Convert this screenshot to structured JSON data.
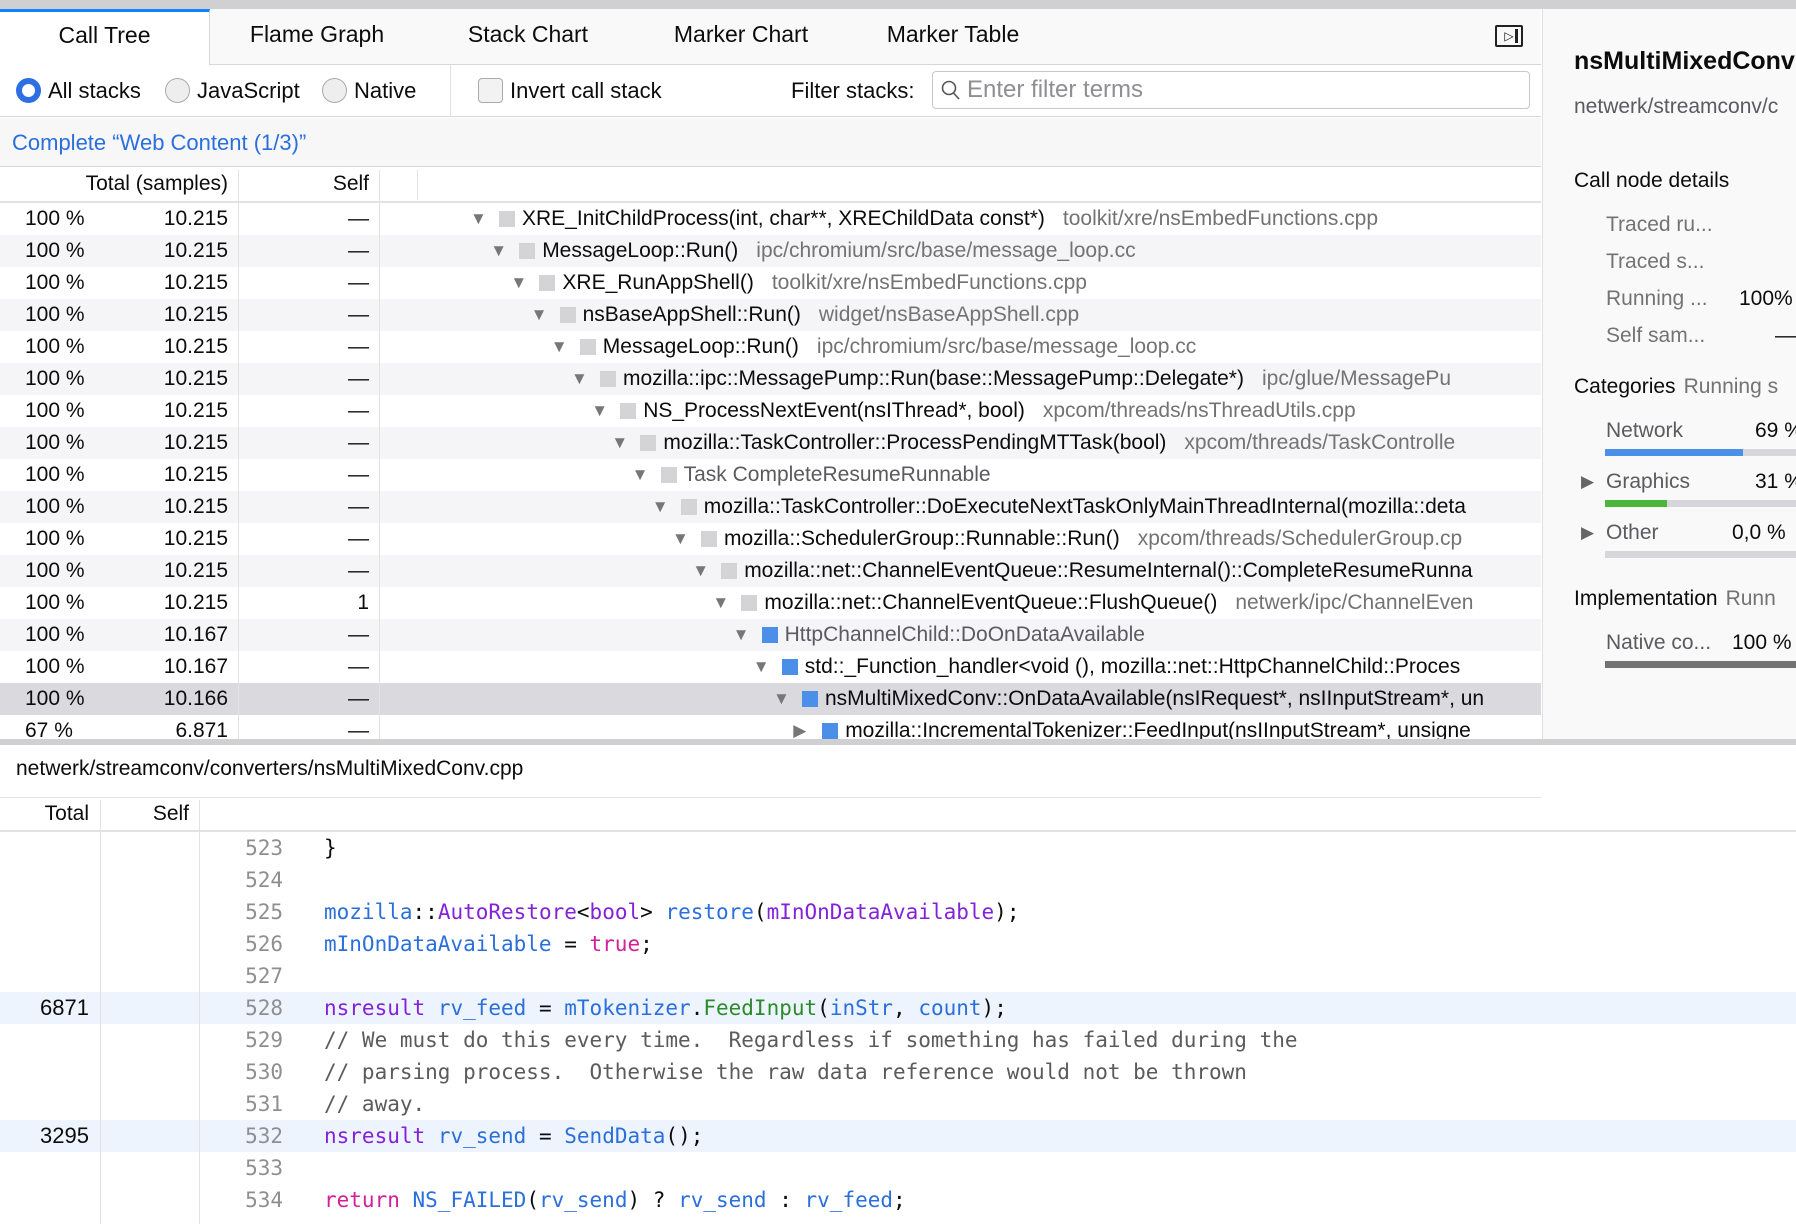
{
  "tabs": [
    {
      "label": "Call Tree",
      "selected": true
    },
    {
      "label": "Flame Graph"
    },
    {
      "label": "Stack Chart"
    },
    {
      "label": "Marker Chart"
    },
    {
      "label": "Marker Table"
    }
  ],
  "options": {
    "stack_types": [
      {
        "label": "All stacks",
        "checked": true
      },
      {
        "label": "JavaScript",
        "checked": false
      },
      {
        "label": "Native",
        "checked": false
      }
    ],
    "invert_label": "Invert call stack",
    "invert_checked": false,
    "filter_label": "Filter stacks:",
    "filter_placeholder": "Enter filter terms",
    "filter_value": ""
  },
  "breadcrumb": "Complete “Web Content (1/3)”",
  "tree": {
    "headers": {
      "total": "Total (samples)",
      "self": "Self"
    },
    "rows": [
      {
        "pct": "100 %",
        "total": "10.215",
        "self": "—",
        "depth": 0,
        "open": true,
        "cat": "#d4d4d7",
        "name": "XRE_InitChildProcess(int, char**, XREChildData const*)",
        "lib": "toolkit/xre/nsEmbedFunctions.cpp"
      },
      {
        "pct": "100 %",
        "total": "10.215",
        "self": "—",
        "depth": 1,
        "open": true,
        "cat": "#d4d4d7",
        "name": "MessageLoop::Run()",
        "lib": "ipc/chromium/src/base/message_loop.cc"
      },
      {
        "pct": "100 %",
        "total": "10.215",
        "self": "—",
        "depth": 2,
        "open": true,
        "cat": "#d4d4d7",
        "name": "XRE_RunAppShell()",
        "lib": "toolkit/xre/nsEmbedFunctions.cpp"
      },
      {
        "pct": "100 %",
        "total": "10.215",
        "self": "—",
        "depth": 3,
        "open": true,
        "cat": "#d4d4d7",
        "name": "nsBaseAppShell::Run()",
        "lib": "widget/nsBaseAppShell.cpp"
      },
      {
        "pct": "100 %",
        "total": "10.215",
        "self": "—",
        "depth": 4,
        "open": true,
        "cat": "#d4d4d7",
        "name": "MessageLoop::Run()",
        "lib": "ipc/chromium/src/base/message_loop.cc"
      },
      {
        "pct": "100 %",
        "total": "10.215",
        "self": "—",
        "depth": 5,
        "open": true,
        "cat": "#d4d4d7",
        "name": "mozilla::ipc::MessagePump::Run(base::MessagePump::Delegate*)",
        "lib": "ipc/glue/MessagePu"
      },
      {
        "pct": "100 %",
        "total": "10.215",
        "self": "—",
        "depth": 6,
        "open": true,
        "cat": "#d4d4d7",
        "name": "NS_ProcessNextEvent(nsIThread*, bool)",
        "lib": "xpcom/threads/nsThreadUtils.cpp"
      },
      {
        "pct": "100 %",
        "total": "10.215",
        "self": "—",
        "depth": 7,
        "open": true,
        "cat": "#d4d4d7",
        "name": "mozilla::TaskController::ProcessPendingMTTask(bool)",
        "lib": "xpcom/threads/TaskControlle"
      },
      {
        "pct": "100 %",
        "total": "10.215",
        "self": "—",
        "depth": 8,
        "open": true,
        "cat": "#d4d4d7",
        "name": "Task CompleteResumeRunnable",
        "lib": "",
        "dim": true
      },
      {
        "pct": "100 %",
        "total": "10.215",
        "self": "—",
        "depth": 9,
        "open": true,
        "cat": "#d4d4d7",
        "name": "mozilla::TaskController::DoExecuteNextTaskOnlyMainThreadInternal(mozilla::deta",
        "lib": ""
      },
      {
        "pct": "100 %",
        "total": "10.215",
        "self": "—",
        "depth": 10,
        "open": true,
        "cat": "#d4d4d7",
        "name": "mozilla::SchedulerGroup::Runnable::Run()",
        "lib": "xpcom/threads/SchedulerGroup.cp"
      },
      {
        "pct": "100 %",
        "total": "10.215",
        "self": "—",
        "depth": 11,
        "open": true,
        "cat": "#d4d4d7",
        "name": "mozilla::net::ChannelEventQueue::ResumeInternal()::CompleteResumeRunna",
        "lib": ""
      },
      {
        "pct": "100 %",
        "total": "10.215",
        "self": "1",
        "depth": 12,
        "open": true,
        "cat": "#d4d4d7",
        "name": "mozilla::net::ChannelEventQueue::FlushQueue()",
        "lib": "netwerk/ipc/ChannelEven"
      },
      {
        "pct": "100 %",
        "total": "10.167",
        "self": "—",
        "depth": 13,
        "open": true,
        "cat": "#4a90e8",
        "name": "HttpChannelChild::DoOnDataAvailable",
        "lib": "",
        "dim": true
      },
      {
        "pct": "100 %",
        "total": "10.167",
        "self": "—",
        "depth": 14,
        "open": true,
        "cat": "#4a90e8",
        "name": "std::_Function_handler<void (), mozilla::net::HttpChannelChild::Proces",
        "lib": ""
      },
      {
        "pct": "100 %",
        "total": "10.166",
        "self": "—",
        "depth": 15,
        "open": true,
        "cat": "#4a90e8",
        "name": "nsMultiMixedConv::OnDataAvailable(nsIRequest*, nsIInputStream*, un",
        "lib": "",
        "selected": true
      },
      {
        "pct": "67 %",
        "total": "6.871",
        "self": "—",
        "depth": 16,
        "open": false,
        "cat": "#4a90e8",
        "name": "mozilla::IncrementalTokenizer::FeedInput(nsIInputStream*, unsigne",
        "lib": ""
      }
    ]
  },
  "source": {
    "path": "netwerk/streamconv/converters/nsMultiMixedConv.cpp",
    "headers": {
      "total": "Total",
      "self": "Self"
    },
    "lines": [
      {
        "no": "523",
        "total": "",
        "tokens": [
          [
            "p",
            "}"
          ]
        ]
      },
      {
        "no": "524",
        "total": "",
        "tokens": []
      },
      {
        "no": "525",
        "total": "",
        "tokens": [
          [
            "id",
            "mozilla"
          ],
          [
            "p",
            "::"
          ],
          [
            "type",
            "AutoRestore"
          ],
          [
            "p",
            "<"
          ],
          [
            "type",
            "bool"
          ],
          [
            "p",
            "> "
          ],
          [
            "id",
            "restore"
          ],
          [
            "p",
            "("
          ],
          [
            "type",
            "mInOnDataAvailable"
          ],
          [
            "p",
            ");"
          ]
        ]
      },
      {
        "no": "526",
        "total": "",
        "tokens": [
          [
            "id",
            "mInOnDataAvailable"
          ],
          [
            "p",
            " = "
          ],
          [
            "kw",
            "true"
          ],
          [
            "p",
            ";"
          ]
        ]
      },
      {
        "no": "527",
        "total": "",
        "tokens": []
      },
      {
        "no": "528",
        "total": "6871",
        "tokens": [
          [
            "type",
            "nsresult"
          ],
          [
            "p",
            " "
          ],
          [
            "id",
            "rv_feed"
          ],
          [
            "p",
            " = "
          ],
          [
            "id",
            "mTokenizer"
          ],
          [
            "p",
            "."
          ],
          [
            "fn",
            "FeedInput"
          ],
          [
            "p",
            "("
          ],
          [
            "id",
            "inStr"
          ],
          [
            "p",
            ", "
          ],
          [
            "id",
            "count"
          ],
          [
            "p",
            ");"
          ]
        ]
      },
      {
        "no": "529",
        "total": "",
        "tokens": [
          [
            "cm",
            "// We must do this every time.  Regardless if something has failed during the"
          ]
        ]
      },
      {
        "no": "530",
        "total": "",
        "tokens": [
          [
            "cm",
            "// parsing process.  Otherwise the raw data reference would not be thrown"
          ]
        ]
      },
      {
        "no": "531",
        "total": "",
        "tokens": [
          [
            "cm",
            "// away."
          ]
        ]
      },
      {
        "no": "532",
        "total": "3295",
        "tokens": [
          [
            "type",
            "nsresult"
          ],
          [
            "p",
            " "
          ],
          [
            "id",
            "rv_send"
          ],
          [
            "p",
            " = "
          ],
          [
            "id",
            "SendData"
          ],
          [
            "p",
            "();"
          ]
        ]
      },
      {
        "no": "533",
        "total": "",
        "tokens": []
      },
      {
        "no": "534",
        "total": "",
        "tokens": [
          [
            "kw",
            "return"
          ],
          [
            "p",
            " "
          ],
          [
            "id",
            "NS_FAILED"
          ],
          [
            "p",
            "("
          ],
          [
            "id",
            "rv_send"
          ],
          [
            "p",
            ") ? "
          ],
          [
            "id",
            "rv_send"
          ],
          [
            "p",
            " : "
          ],
          [
            "id",
            "rv_feed"
          ],
          [
            "p",
            ";"
          ]
        ]
      }
    ]
  },
  "sidebar": {
    "title": "nsMultiMixedConv",
    "path": "netwerk/streamconv/c",
    "call_node_heading": "Call node details",
    "details": [
      {
        "label": "Traced ru...",
        "value": ""
      },
      {
        "label": "Traced s...",
        "value": ""
      },
      {
        "label": "Running ...",
        "value": "100%"
      },
      {
        "label": "Self sam...",
        "value": "—"
      }
    ],
    "categories_heading": "Categories",
    "categories_sub": "Running s",
    "categories": [
      {
        "label": "Network",
        "value": "69 %",
        "fraction": 0.69,
        "color": "#4a90e8",
        "expandable": false
      },
      {
        "label": "Graphics",
        "value": "31 %",
        "fraction": 0.31,
        "color": "#4cb63a",
        "expandable": true
      },
      {
        "label": "Other",
        "value": "0,0 %",
        "fraction": 0.0,
        "color": "#8e8e93",
        "expandable": true
      }
    ],
    "impl_heading": "Implementation",
    "impl_sub": "Runn",
    "impl": [
      {
        "label": "Native co...",
        "value": "100 %",
        "fraction": 1.0,
        "color": "#737373"
      }
    ]
  }
}
